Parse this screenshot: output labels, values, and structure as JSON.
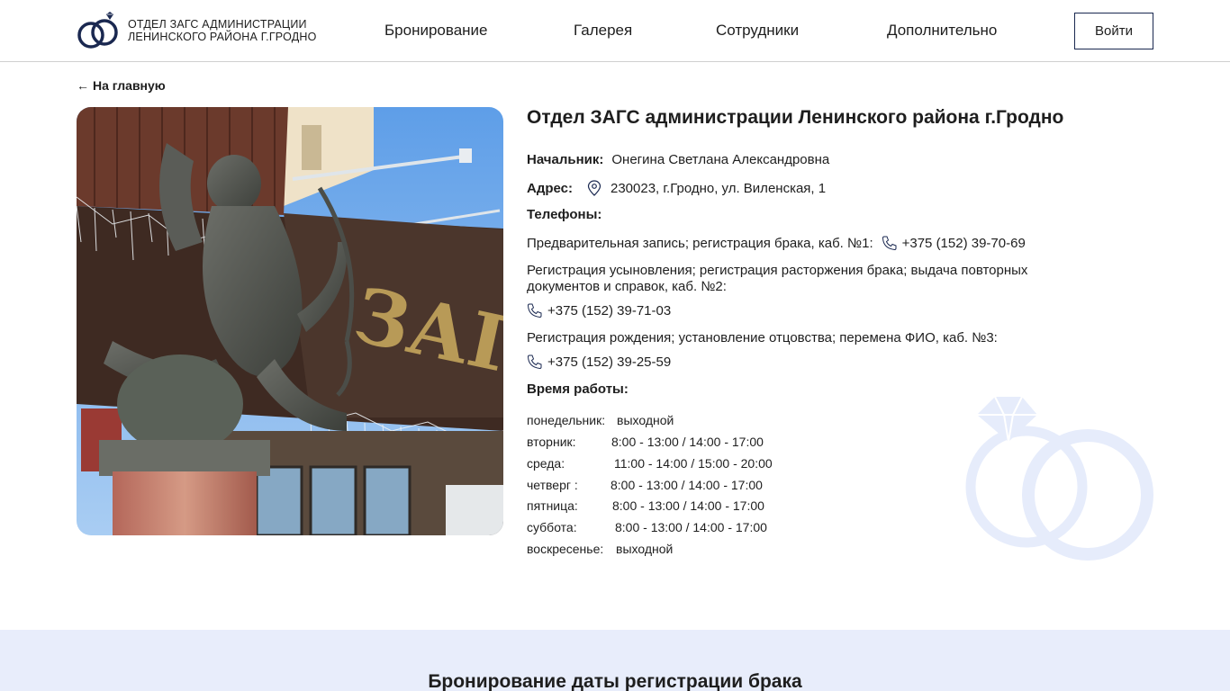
{
  "header": {
    "logo_line1": "ОТДЕЛ ЗАГС АДМИНИСТРАЦИИ",
    "logo_line2": "ЛЕНИНСКОГО РАЙОНА Г.ГРОДНО",
    "nav": [
      "Бронирование",
      "Галерея",
      "Сотрудники",
      "Дополнительно"
    ],
    "login_label": "Войти"
  },
  "back_link": "На главную",
  "office": {
    "title": "Отдел ЗАГС администрации Ленинского района г.Гродно",
    "head_label": "Начальник:",
    "head_name": "Онегина Светлана Александровна",
    "address_label": "Адрес:",
    "address": "230023, г.Гродно, ул. Виленская, 1",
    "phones_label": "Телефоны:",
    "phone1_desc": "Предварительная запись; регистрация брака, каб. №1:",
    "phone1": "+375 (152) 39-70-69",
    "phone2_desc": "Регистрация усыновления; регистрация расторжения брака; выдача повторных документов и справок, каб. №2:",
    "phone2": "+375 (152) 39-71-03",
    "phone3_desc": "Регистрация рождения; установление отцовства; перемена ФИО, каб. №3:",
    "phone3": "+375 (152) 39-25-59",
    "hours_label": "Время работы:",
    "schedule": [
      {
        "day": "понедельник:",
        "time": "выходной"
      },
      {
        "day": "вторник:",
        "time": "8:00 - 13:00 / 14:00 - 17:00"
      },
      {
        "day": "среда:",
        "time": "11:00 - 14:00 / 15:00 - 20:00"
      },
      {
        "day": "четверг :",
        "time": "8:00 - 13:00 / 14:00 - 17:00"
      },
      {
        "day": "пятница:",
        "time": "8:00 - 13:00 / 14:00 - 17:00"
      },
      {
        "day": "суббота:",
        "time": "8:00 - 13:00 / 14:00 - 17:00"
      },
      {
        "day": "воскресенье:",
        "time": "выходной"
      }
    ]
  },
  "photo_sign": "ЗАГС",
  "booking_title": "Бронирование даты регистрации брака",
  "colors": {
    "brand_navy": "#1a2850",
    "band_bg": "#e8edfb",
    "rings_watermark": "#e6ecfb"
  }
}
